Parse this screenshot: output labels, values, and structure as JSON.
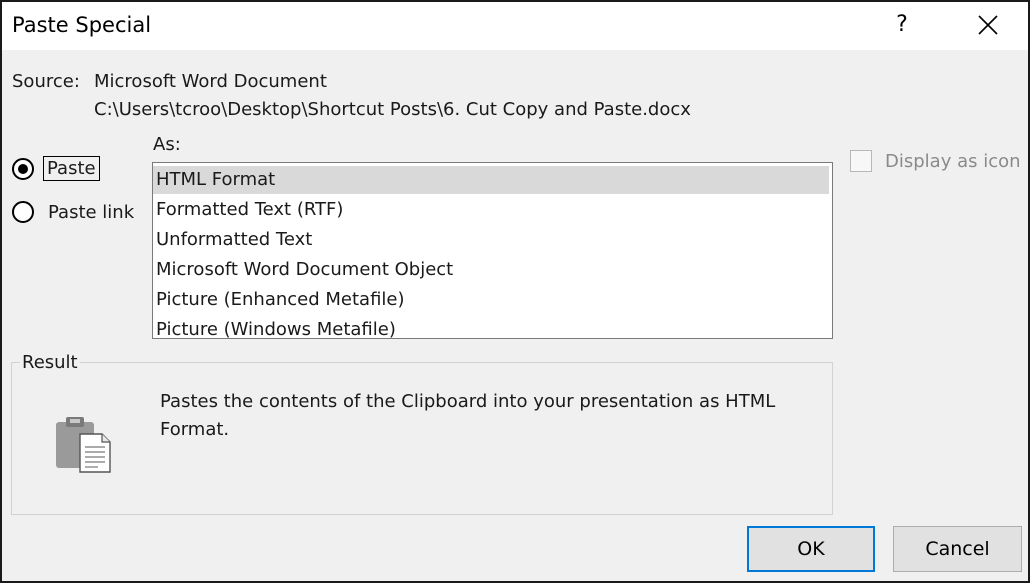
{
  "window": {
    "title": "Paste Special",
    "help_label": "?"
  },
  "source": {
    "label": "Source:",
    "name": "Microsoft Word Document",
    "path": "C:\\Users\\tcroo\\Desktop\\Shortcut Posts\\6. Cut Copy and Paste.docx"
  },
  "options": {
    "paste_label": "Paste",
    "paste_link_label": "Paste link",
    "selected": "Paste"
  },
  "as": {
    "label": "As:",
    "items": [
      "HTML Format",
      "Formatted Text (RTF)",
      "Unformatted Text",
      "Microsoft Word Document Object",
      "Picture (Enhanced Metafile)",
      "Picture (Windows Metafile)"
    ],
    "selected_index": 0
  },
  "display_as_icon": {
    "label": "Display as icon",
    "checked": false,
    "enabled": false
  },
  "result": {
    "label": "Result",
    "text": "Pastes the contents of the Clipboard into your presentation as HTML Format."
  },
  "buttons": {
    "ok_label": "OK",
    "cancel_label": "Cancel"
  },
  "icons": {
    "close": "close-icon",
    "clipboard": "clipboard-icon"
  },
  "colors": {
    "focus_border": "#0078d7",
    "selection_bg": "#d9d9d9",
    "dialog_bg": "#f0f0f0"
  }
}
